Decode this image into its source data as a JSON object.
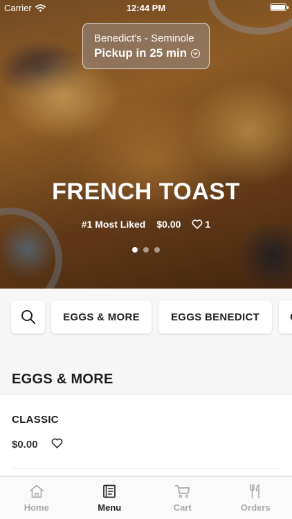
{
  "status_bar": {
    "carrier": "Carrier",
    "time": "12:44 PM"
  },
  "location": {
    "name": "Benedict's - Seminole",
    "pickup": "Pickup in 25 min"
  },
  "hero": {
    "title": "FRENCH TOAST",
    "badge": "#1 Most Liked",
    "price": "$0.00",
    "likes": "1",
    "carousel_active_index": 0,
    "carousel_count": 3
  },
  "categories": {
    "items": [
      "EGGS & MORE",
      "EGGS BENEDICT",
      "O"
    ]
  },
  "section": {
    "title": "EGGS & MORE"
  },
  "items": [
    {
      "name": "CLASSIC",
      "price": "$0.00"
    }
  ],
  "tabs": [
    {
      "label": "Home",
      "icon": "home-icon"
    },
    {
      "label": "Menu",
      "icon": "menu-icon",
      "active": true
    },
    {
      "label": "Cart",
      "icon": "cart-icon"
    },
    {
      "label": "Orders",
      "icon": "orders-icon"
    }
  ],
  "colors": {
    "active_tab": "#222222",
    "inactive_tab": "#aaaaaa",
    "background": "#f7f7f7"
  }
}
